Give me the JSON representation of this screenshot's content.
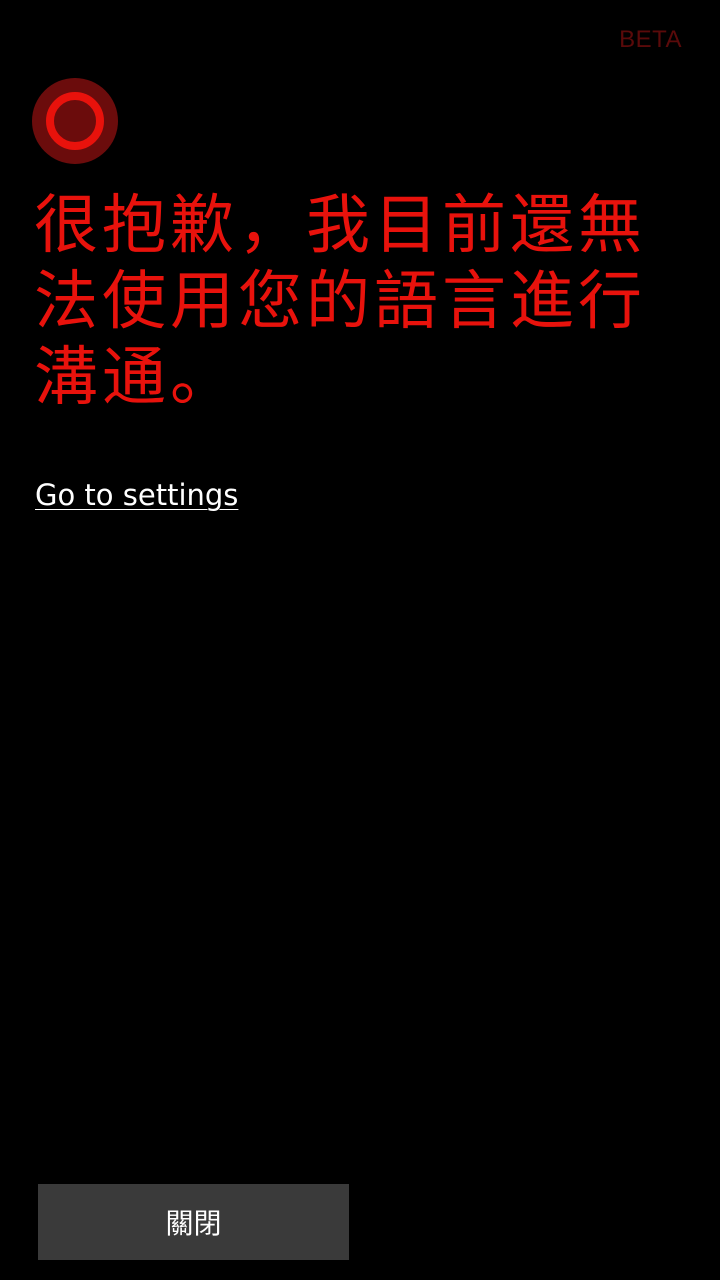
{
  "header": {
    "badge": "BETA"
  },
  "logo": {
    "icon": "cortana-ring-icon",
    "outer_color": "#6b0c0c",
    "ring_color": "#e8120c"
  },
  "main": {
    "message": "很抱歉，我目前還無法使用您的語言進行溝通。",
    "settings_link": "Go to settings"
  },
  "footer": {
    "close_label": "關閉"
  },
  "colors": {
    "accent": "#e8120c",
    "background": "#000000",
    "button_bg": "#3a3a3a"
  }
}
